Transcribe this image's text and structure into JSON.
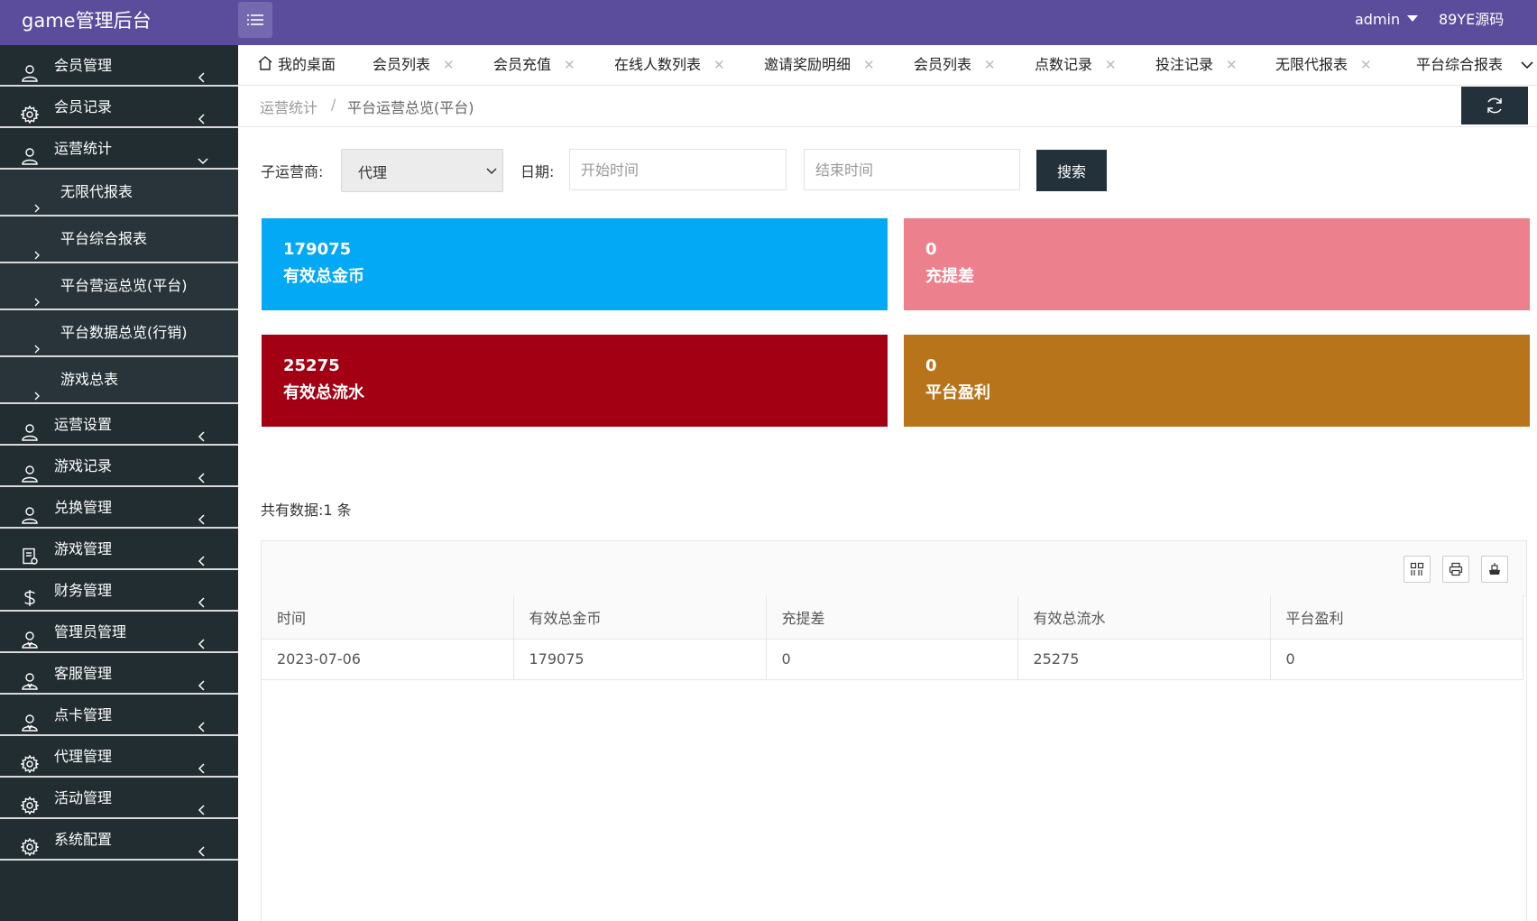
{
  "app": {
    "title": "game管理后台",
    "user": "admin",
    "brand": "89YE源码"
  },
  "sidebar": {
    "items": [
      {
        "label": "会员管理",
        "icon": "user-icon",
        "arrow": "left"
      },
      {
        "label": "会员记录",
        "icon": "gear-icon",
        "arrow": "left"
      },
      {
        "label": "运营统计",
        "icon": "user-icon",
        "arrow": "down"
      },
      {
        "label": "运营设置",
        "icon": "user-icon",
        "arrow": "left"
      },
      {
        "label": "游戏记录",
        "icon": "user-icon",
        "arrow": "left"
      },
      {
        "label": "兑换管理",
        "icon": "user-icon",
        "arrow": "left"
      },
      {
        "label": "游戏管理",
        "icon": "document-icon",
        "arrow": "left"
      },
      {
        "label": "财务管理",
        "icon": "dollar-icon",
        "arrow": "left"
      },
      {
        "label": "管理员管理",
        "icon": "admin-user-icon",
        "arrow": "left"
      },
      {
        "label": "客服管理",
        "icon": "admin-user-icon",
        "arrow": "left"
      },
      {
        "label": "点卡管理",
        "icon": "admin-user-icon",
        "arrow": "left"
      },
      {
        "label": "代理管理",
        "icon": "gear-icon",
        "arrow": "left"
      },
      {
        "label": "活动管理",
        "icon": "gear-icon",
        "arrow": "left"
      },
      {
        "label": "系统配置",
        "icon": "gear-icon",
        "arrow": "left"
      }
    ],
    "sub_items": [
      "无限代报表",
      "平台综合报表",
      "平台营运总览(平台)",
      "平台数据总览(行销)",
      "游戏总表"
    ]
  },
  "tabs": [
    {
      "label": "我的桌面",
      "closable": false
    },
    {
      "label": "会员列表",
      "closable": true
    },
    {
      "label": "会员充值",
      "closable": true
    },
    {
      "label": "在线人数列表",
      "closable": true
    },
    {
      "label": "邀请奖励明细",
      "closable": true
    },
    {
      "label": "会员列表",
      "closable": true
    },
    {
      "label": "点数记录",
      "closable": true
    },
    {
      "label": "投注记录",
      "closable": true
    },
    {
      "label": "无限代报表",
      "closable": true
    },
    {
      "label": "平台综合报表",
      "closable": false
    }
  ],
  "tab_close_glyph": "✕",
  "breadcrumb": {
    "parent": "运营统计",
    "separator": "/",
    "current": "平台运营总览(平台)"
  },
  "filters": {
    "operator_label": "子运营商:",
    "operator_value": "代理",
    "date_label": "日期:",
    "start_placeholder": "开始时间",
    "end_placeholder": "结束时间",
    "search_label": "搜索"
  },
  "cards": [
    {
      "value": "179075",
      "label": "有效总金币",
      "color": "#03a9f4"
    },
    {
      "value": "0",
      "label": "充提差",
      "color": "#ec808d"
    },
    {
      "value": "25275",
      "label": "有效总流水",
      "color": "#a30014"
    },
    {
      "value": "0",
      "label": "平台盈利",
      "color": "#b8741a"
    }
  ],
  "record_count": "共有数据:1 条",
  "table": {
    "columns": [
      "时间",
      "有效总金币",
      "充提差",
      "有效总流水",
      "平台盈利"
    ],
    "rows": [
      [
        "2023-07-06",
        "179075",
        "0",
        "25275",
        "0"
      ]
    ]
  },
  "colors": {
    "header": "#5b4d9c",
    "sidebar": "#222d32",
    "button_dark": "#22313a"
  }
}
